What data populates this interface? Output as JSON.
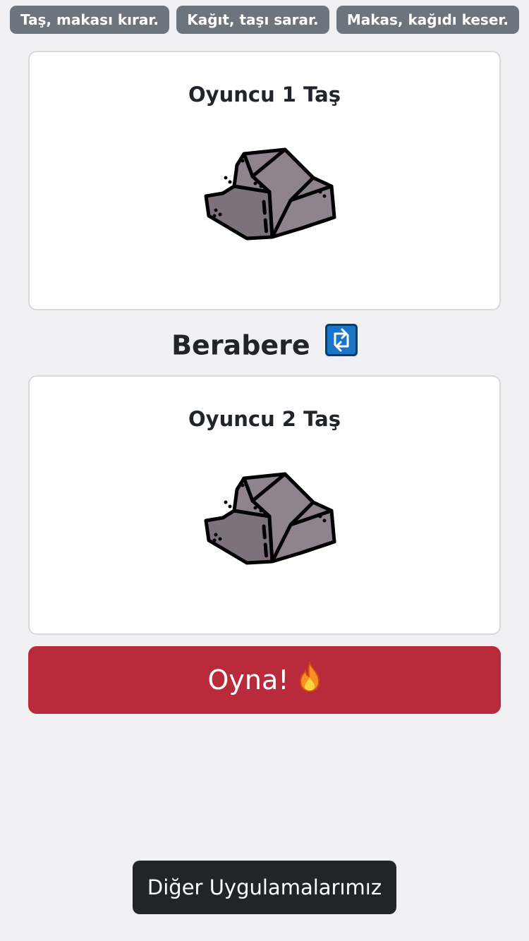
{
  "rules": [
    "Taş, makası kırar.",
    "Kağıt, taşı sarar.",
    "Makas, kağıdı keser."
  ],
  "player1": {
    "label": "Oyuncu 1 Taş",
    "choice_icon": "rock-icon"
  },
  "player2": {
    "label": "Oyuncu 2 Taş",
    "choice_icon": "rock-icon"
  },
  "result": {
    "text": "Berabere",
    "icon": "repeat-arrows-icon"
  },
  "play_button": {
    "label": "Oyna!",
    "icon": "fire-icon"
  },
  "other_apps_button": {
    "label": "Diğer Uygulamalarımız"
  },
  "colors": {
    "background": "#f1f0f2",
    "rule_badge": "#6c757d",
    "play_button": "#b92a3b",
    "other_apps_button": "#212529",
    "rock": "#8f838e",
    "result_icon": "#1a75c8"
  }
}
